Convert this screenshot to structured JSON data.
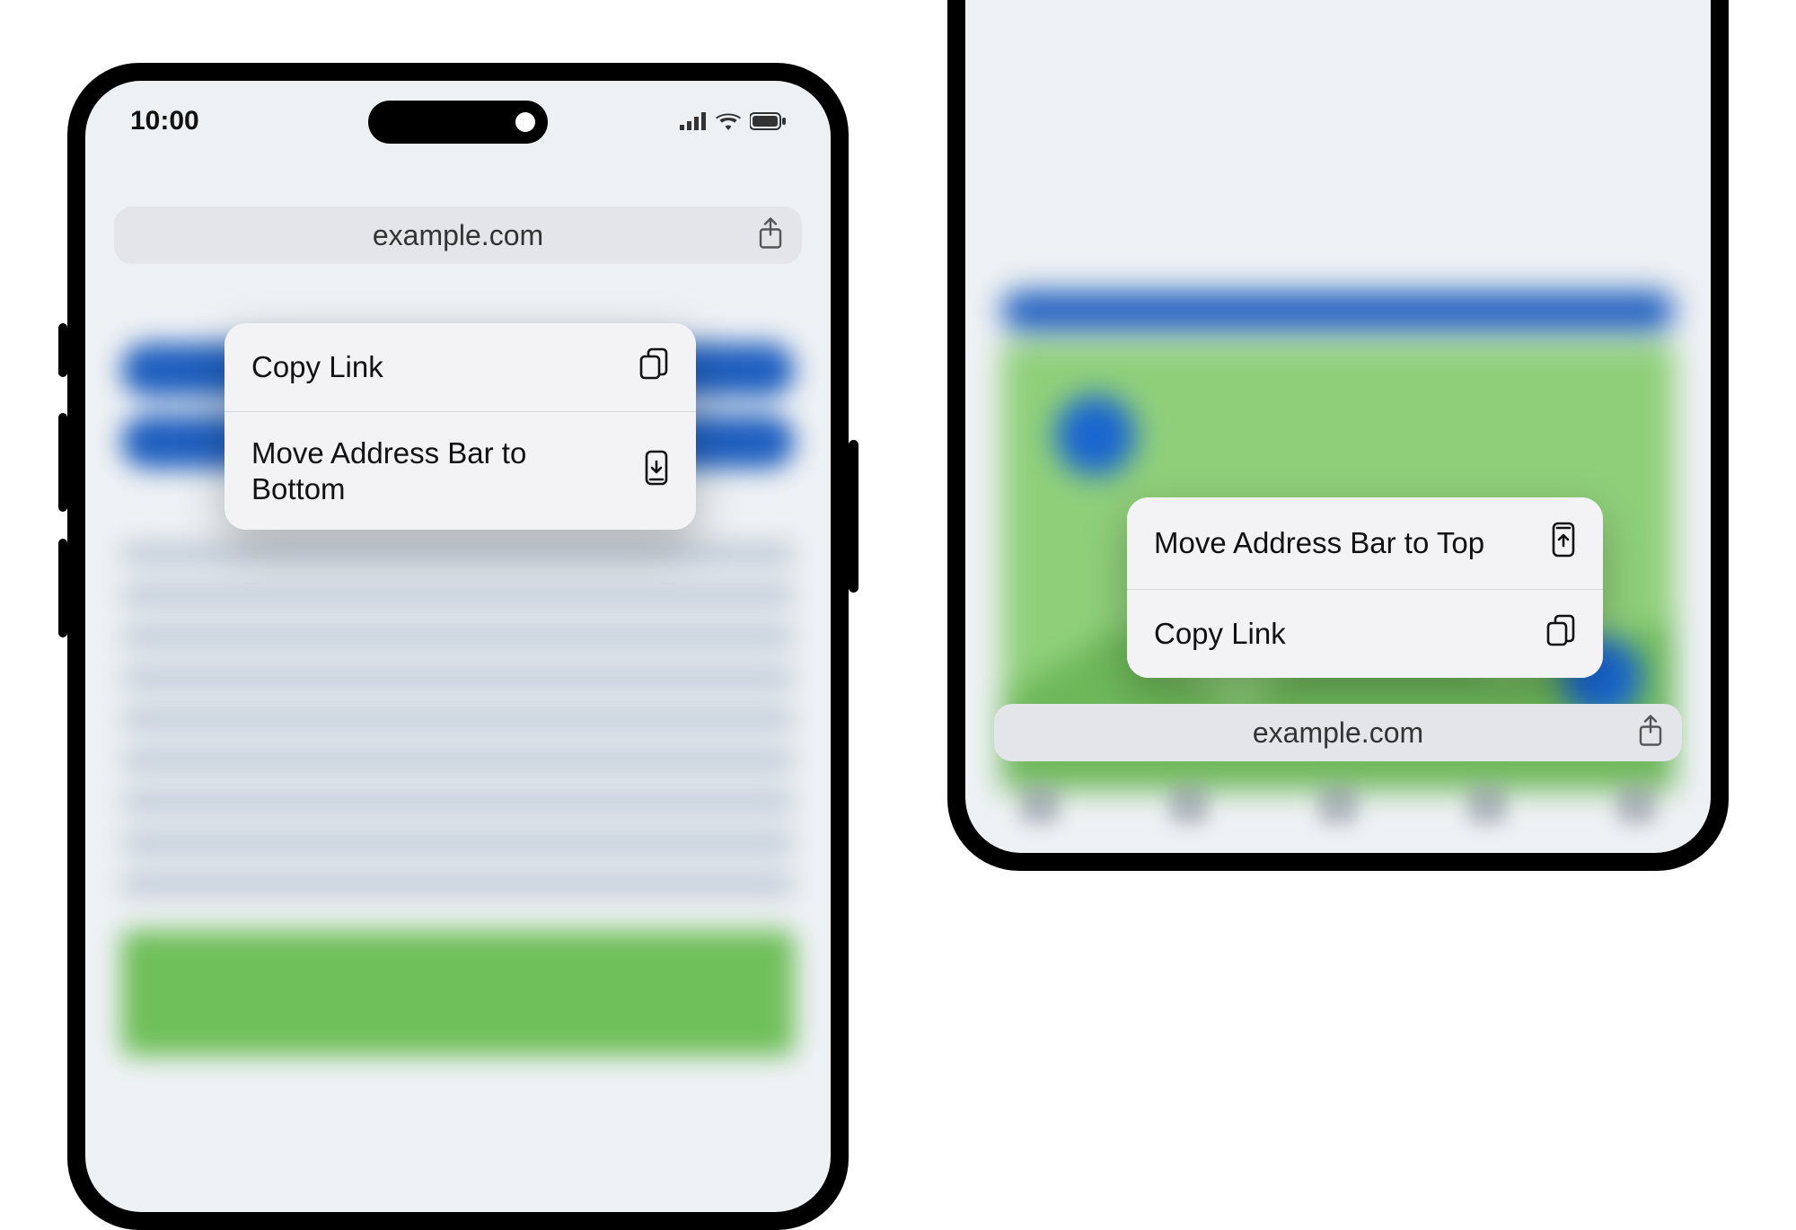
{
  "statusbar": {
    "time": "10:00"
  },
  "left": {
    "url": "example.com",
    "menu": {
      "copy_link": "Copy Link",
      "move_bottom": "Move Address Bar to Bottom"
    }
  },
  "right": {
    "url": "example.com",
    "menu": {
      "move_top": "Move Address Bar to Top",
      "copy_link": "Copy Link"
    }
  }
}
